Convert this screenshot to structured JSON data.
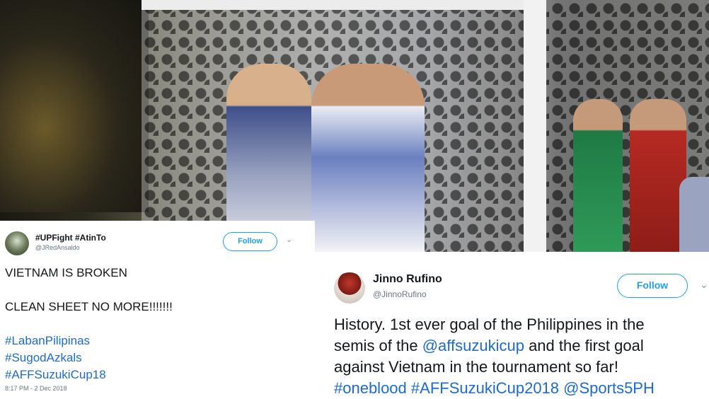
{
  "photo": {
    "description_icon": "soccer-photo"
  },
  "tweet1": {
    "name": "#UPFight #AtinTo",
    "handle": "@JRedAnsaldo",
    "follow_label": "Follow",
    "chevron": "⌄",
    "lines": {
      "l1": "VIETNAM IS BROKEN",
      "l2": "CLEAN SHEET NO MORE!!!!!!!",
      "h1": "#LabanPilipinas",
      "h2": "#SugodAzkals",
      "h3": "#AFFSuzukiCup18"
    },
    "time": "8:17 PM - 2 Dec 2018"
  },
  "tweet2": {
    "name": "Jinno Rufino",
    "handle": "@JinnoRufino",
    "follow_label": "Follow",
    "chevron": "⌄",
    "text": {
      "l1": "History. 1st ever goal of the Philippines in the",
      "l2a": "semis of the ",
      "l2b": "@affsuzukicup",
      "l2c": " and the first goal",
      "l3": "against Vietnam in the tournament so far!",
      "l4a": "#oneblood",
      "l4b": "#AFFSuzukiCup2018",
      "l4c": "@Sports5PH"
    }
  },
  "colors": {
    "link": "#1b6bd1",
    "follow": "#1da1f2"
  }
}
